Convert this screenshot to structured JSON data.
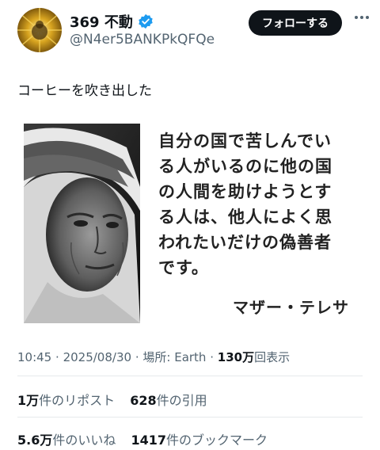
{
  "header": {
    "display_name": "369 不動",
    "handle": "@N4er5BANKPkQFQe",
    "follow_label": "フォローする",
    "verified": true
  },
  "tweet": {
    "text": "コーヒーを吹き出した"
  },
  "image": {
    "quote_lines": [
      "自分の国で苦しんでい",
      "る人がいるのに他の国",
      "の人間を助けようとす",
      "る人は、他人によく思",
      "われたいだけの偽善者",
      "です。"
    ],
    "author": "マザー・テレサ"
  },
  "meta": {
    "time": "10:45",
    "sep1": "·",
    "date": "2025/08/30",
    "sep2": "·",
    "location": "場所: Earth",
    "sep3": "·",
    "views_count": "130万",
    "views_label": "回表示"
  },
  "stats": {
    "reposts_count": "1万",
    "reposts_label": "件のリポスト",
    "quotes_count": "628",
    "quotes_label": "件の引用",
    "likes_count": "5.6万",
    "likes_label": "件のいいね",
    "bookmarks_count": "1417",
    "bookmarks_label": "件のブックマーク"
  },
  "colors": {
    "text": "#0f1419",
    "secondary": "#536471",
    "verified_blue": "#1d9bf0",
    "avatar_gold": "#c9a227"
  }
}
